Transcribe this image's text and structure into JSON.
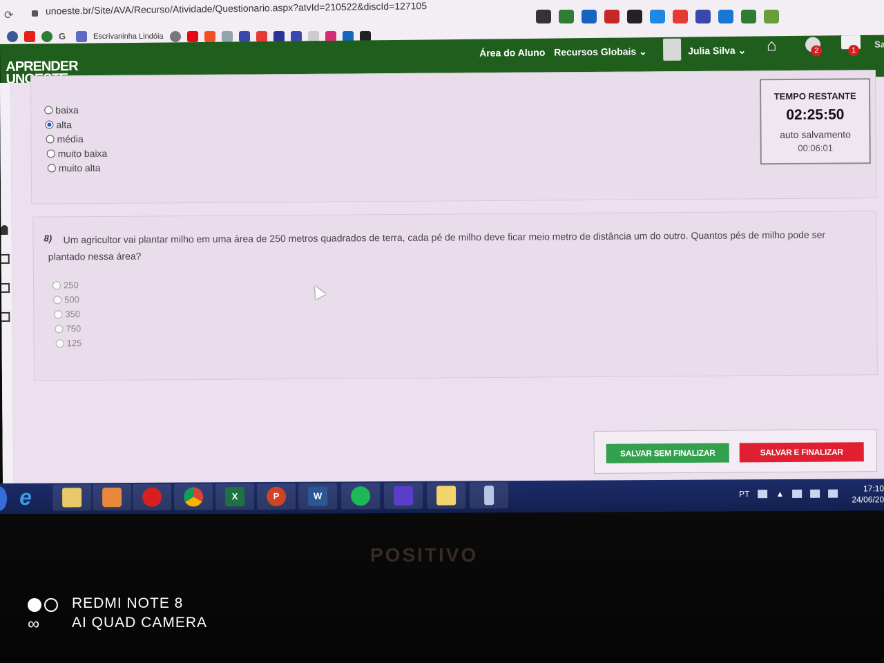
{
  "browser": {
    "url": "unoeste.br/Site/AVA/Recurso/Atividade/Questionario.aspx?atvId=210522&discId=127105",
    "bookmark_label": "Escrivaninha Lindóia"
  },
  "header": {
    "logo_line1": "APRENDER",
    "logo_line2": "UNOESTE",
    "nav_student": "Área do Aluno",
    "nav_resources": "Recursos Globais",
    "user_name": "Julia Silva",
    "notif_count": "2",
    "mail_count": "1",
    "cut_text": "Sa"
  },
  "timer": {
    "title": "TEMPO RESTANTE",
    "value": "02:25:50",
    "autosave_label": "auto salvamento",
    "autosave_value": "00:06:01"
  },
  "prev_question": {
    "options": [
      {
        "label": "baixa",
        "selected": false
      },
      {
        "label": "alta",
        "selected": true
      },
      {
        "label": "média",
        "selected": false
      },
      {
        "label": "muito baixa",
        "selected": false
      },
      {
        "label": "muito alta",
        "selected": false
      }
    ]
  },
  "question8": {
    "number": "8)",
    "text": "Um agricultor vai plantar milho em uma área de 250 metros quadrados de terra, cada pé de milho deve ficar meio metro de distância um do outro. Quantos pés de milho pode ser plantado nessa área?",
    "options": [
      {
        "label": "250",
        "selected": false
      },
      {
        "label": "500",
        "selected": false
      },
      {
        "label": "350",
        "selected": false
      },
      {
        "label": "750",
        "selected": false
      },
      {
        "label": "125",
        "selected": false
      }
    ]
  },
  "actions": {
    "save_no_finish": "SALVAR SEM FINALIZAR",
    "save_finish": "SALVAR E FINALIZAR"
  },
  "taskbar": {
    "lang": "PT",
    "time": "17:10",
    "date": "24/06/20"
  },
  "monitor": {
    "brand": "POSITIVO"
  },
  "watermark": {
    "line1": "REDMI NOTE 8",
    "line2": "AI QUAD CAMERA"
  },
  "colors": {
    "header_green": "#1f5e1c",
    "save_green": "#32a04c",
    "finish_red": "#e02030",
    "radio_selected": "#2258c9"
  }
}
